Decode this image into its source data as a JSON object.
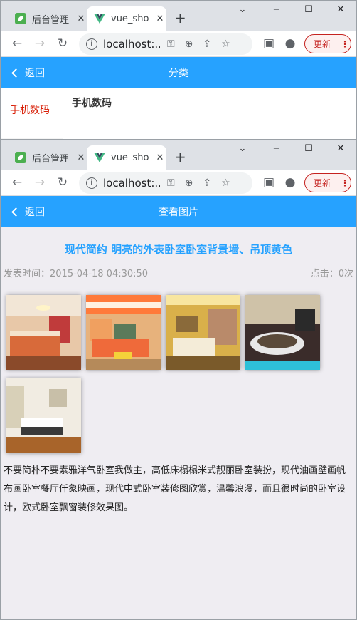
{
  "colors": {
    "accent": "#26a2ff",
    "category_active": "#d81e06",
    "update": "#c5221f"
  },
  "browser": {
    "tabs": [
      {
        "title": "后台管理",
        "icon": "green-leaf-icon"
      },
      {
        "title": "vue_sho",
        "icon": "vue-logo-icon"
      }
    ],
    "new_tab": "+",
    "controls": {
      "minimize": "−",
      "maximize": "☐",
      "close": "✕",
      "dropdown": "⌄"
    },
    "url": "localhost:...",
    "update_label": "更新",
    "menu_label": "⋮"
  },
  "window1": {
    "header": {
      "back_label": "返回",
      "title": "分类"
    },
    "sidebar": {
      "active_item": "手机数码"
    },
    "main": {
      "title": "手机数码"
    }
  },
  "window2": {
    "header": {
      "back_label": "返回",
      "title": "查看图片"
    },
    "photo": {
      "title": "现代简约 明亮的外表卧室卧室背景墙、吊顶黄色",
      "publish_time": "发表时间：2015-04-18 04:30:50",
      "clicks": "点击：0次",
      "thumbnails": [
        {
          "name": "bedroom-orange-red-thumb"
        },
        {
          "name": "bedroom-striped-ceiling-thumb"
        },
        {
          "name": "bedroom-warm-yellow-thumb"
        },
        {
          "name": "bedroom-round-bed-thumb"
        },
        {
          "name": "bedroom-small-wood-thumb"
        }
      ],
      "content": "不要简朴不要素雅洋气卧室我做主，高低床榻榻米式靓丽卧室装扮，现代油画壁画帆布画卧室餐厅仟象映画，现代中式卧室装修图欣赏，温馨浪漫，而且很时尚的卧室设计，欧式卧室飘窗装修效果图。"
    }
  }
}
